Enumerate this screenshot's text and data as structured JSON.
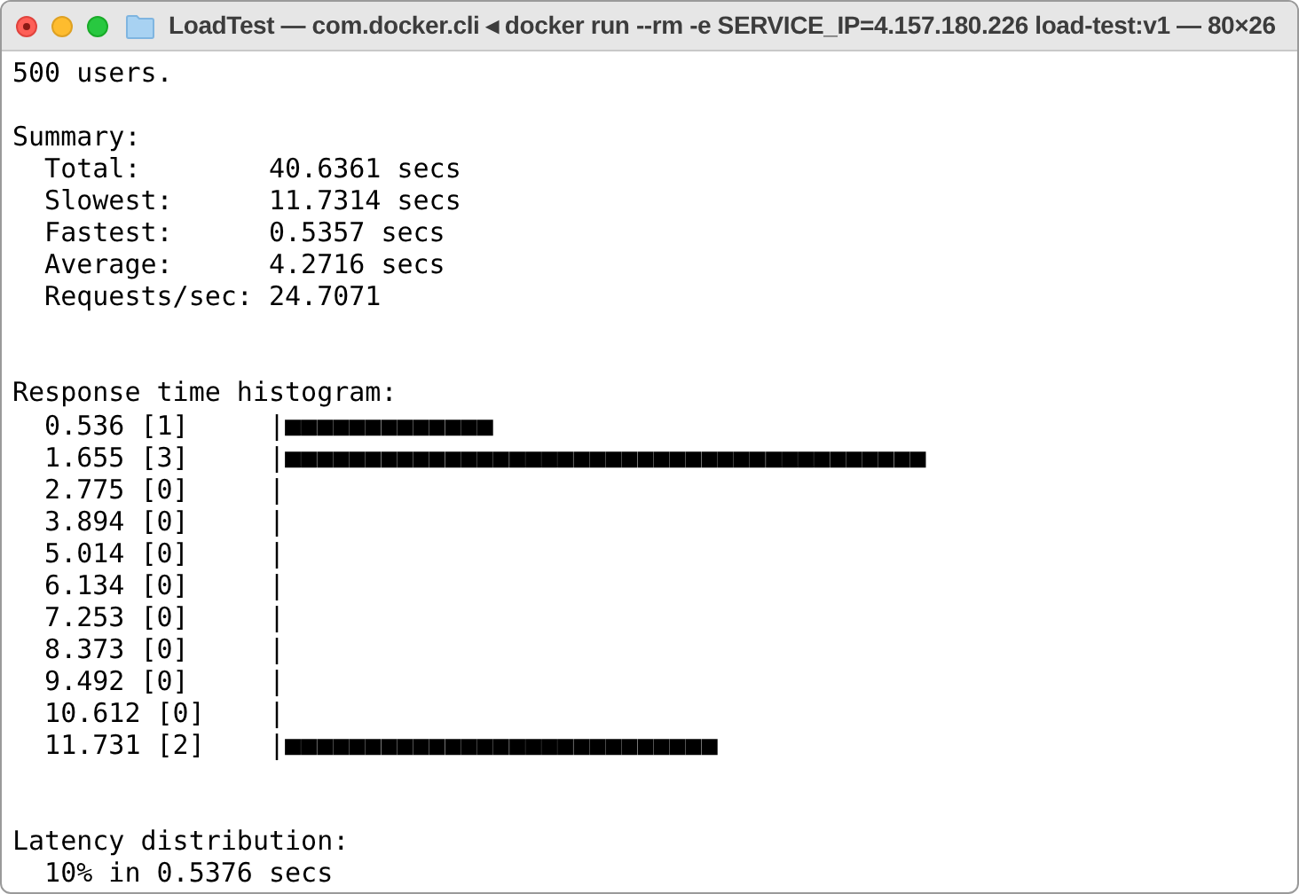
{
  "window": {
    "title": "LoadTest — com.docker.cli ◂ docker run --rm -e SERVICE_IP=4.157.180.226 load-test:v1 — 80×26"
  },
  "lines": [
    {
      "kind": "text",
      "text": "500 users."
    },
    {
      "kind": "blank"
    },
    {
      "kind": "text",
      "text": "Summary:"
    },
    {
      "kind": "text",
      "text": "  Total:        40.6361 secs"
    },
    {
      "kind": "text",
      "text": "  Slowest:      11.7314 secs"
    },
    {
      "kind": "text",
      "text": "  Fastest:      0.5357 secs"
    },
    {
      "kind": "text",
      "text": "  Average:      4.2716 secs"
    },
    {
      "kind": "text",
      "text": "  Requests/sec: 24.7071"
    },
    {
      "kind": "blank"
    },
    {
      "kind": "blank"
    },
    {
      "kind": "text",
      "text": "Response time histogram:"
    },
    {
      "kind": "text",
      "text": "  0.536 [1]     |■■■■■■■■■■■■■"
    },
    {
      "kind": "text",
      "text": "  1.655 [3]     |■■■■■■■■■■■■■■■■■■■■■■■■■■■■■■■■■■■■■■■■"
    },
    {
      "kind": "text",
      "text": "  2.775 [0]     |"
    },
    {
      "kind": "text",
      "text": "  3.894 [0]     |"
    },
    {
      "kind": "text",
      "text": "  5.014 [0]     |"
    },
    {
      "kind": "text",
      "text": "  6.134 [0]     |"
    },
    {
      "kind": "text",
      "text": "  7.253 [0]     |"
    },
    {
      "kind": "text",
      "text": "  8.373 [0]     |"
    },
    {
      "kind": "text",
      "text": "  9.492 [0]     |"
    },
    {
      "kind": "text",
      "text": "  10.612 [0]    |"
    },
    {
      "kind": "text",
      "text": "  11.731 [2]    |■■■■■■■■■■■■■■■■■■■■■■■■■■■"
    },
    {
      "kind": "blank"
    },
    {
      "kind": "blank"
    },
    {
      "kind": "text",
      "text": "Latency distribution:"
    },
    {
      "kind": "text",
      "text": "  10% in 0.5376 secs"
    }
  ]
}
